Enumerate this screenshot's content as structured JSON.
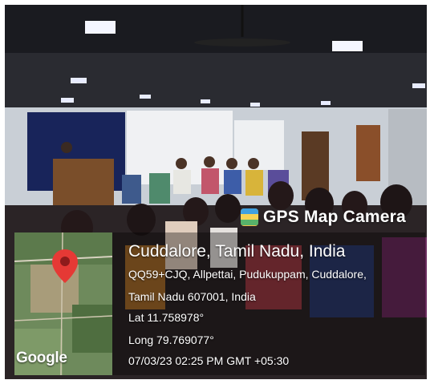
{
  "badge": {
    "label": "GPS Map Camera",
    "icon": "gps-map-camera-icon"
  },
  "location": {
    "title": "Cuddalore, Tamil Nadu, India",
    "address_line1": "QQ59+CJQ, Allpettai, Pudukuppam, Cuddalore,",
    "address_line2": "Tamil Nadu 607001, India",
    "latitude": "Lat 11.758978°",
    "longitude": "Long 79.769077°",
    "timestamp": "07/03/23 02:25 PM GMT +05:30"
  },
  "map": {
    "logo": "Google",
    "pin_icon": "map-pin-icon",
    "pin_color": "#e53935"
  }
}
